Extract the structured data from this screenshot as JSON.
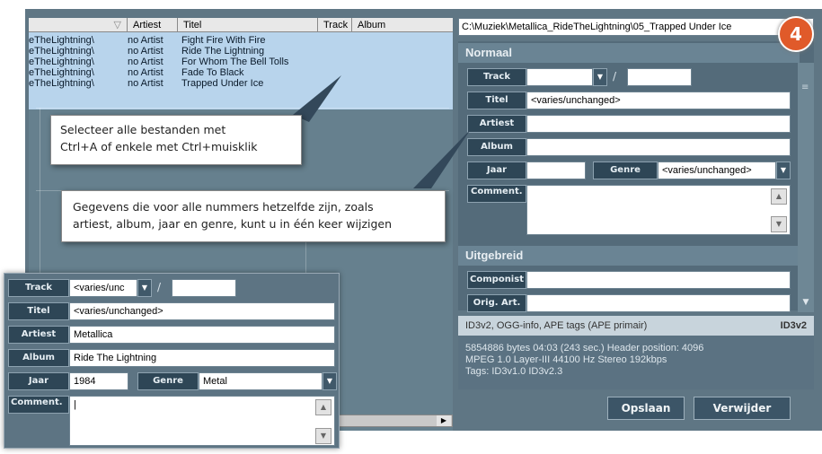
{
  "step_number": "4",
  "list": {
    "columns": [
      "",
      "Artiest",
      "Titel",
      "Track",
      "Album"
    ],
    "rows": [
      {
        "path": "eTheLightning\\",
        "artist": "no Artist",
        "title": "Fight Fire With Fire"
      },
      {
        "path": "eTheLightning\\",
        "artist": "no Artist",
        "title": "Ride The Lightning"
      },
      {
        "path": "eTheLightning\\",
        "artist": "no Artist",
        "title": "For Whom The Bell Tolls"
      },
      {
        "path": "eTheLightning\\",
        "artist": "no Artist",
        "title": "Fade To Black"
      },
      {
        "path": "eTheLightning\\",
        "artist": "no Artist",
        "title": "Trapped Under Ice"
      }
    ]
  },
  "file_path": "C:\\Muziek\\Metallica_RideTheLightning\\05_Trapped Under Ice",
  "sections": {
    "normal": "Normaal",
    "extended": "Uitgebreid"
  },
  "labels": {
    "track": "Track",
    "title": "Titel",
    "artist": "Artiest",
    "album": "Album",
    "year": "Jaar",
    "genre": "Genre",
    "comment": "Comment.",
    "composer": "Componist",
    "orig_artist": "Orig. Art."
  },
  "right_fields": {
    "track": "",
    "track_total": "",
    "track_slash": "/",
    "title": "<varies/unchanged>",
    "artist": "",
    "album": "",
    "year": "",
    "genre": "<varies/unchanged>",
    "comment": "",
    "composer": "",
    "orig_artist": ""
  },
  "tag_info": {
    "tags": "ID3v2, OGG-info, APE tags (APE primair)",
    "version": "ID3v2",
    "line1": "5854886 bytes  04:03 (243 sec.)  Header position: 4096",
    "line2": "MPEG 1.0  Layer-III  44100 Hz  Stereo  192kbps",
    "line3": "Tags: ID3v1.0 ID3v2.3"
  },
  "buttons": {
    "save": "Opslaan",
    "delete": "Verwijder"
  },
  "callouts": {
    "c1_line1": "Selecteer alle bestanden met",
    "c1_line2": "Ctrl+A of enkele met Ctrl+muisklik",
    "c2_line1": "Gegevens die voor alle nummers hetzelfde zijn, zoals",
    "c2_line2": "artiest, album, jaar en genre, kunt u in één keer wijzigen"
  },
  "zoom_fields": {
    "track": "<varies/unc",
    "track_slash": "/",
    "track_total": "",
    "title": "<varies/unchanged>",
    "artist": "Metallica",
    "album": "Ride The Lightning",
    "year": "1984",
    "genre": "Metal",
    "comment": "|"
  }
}
